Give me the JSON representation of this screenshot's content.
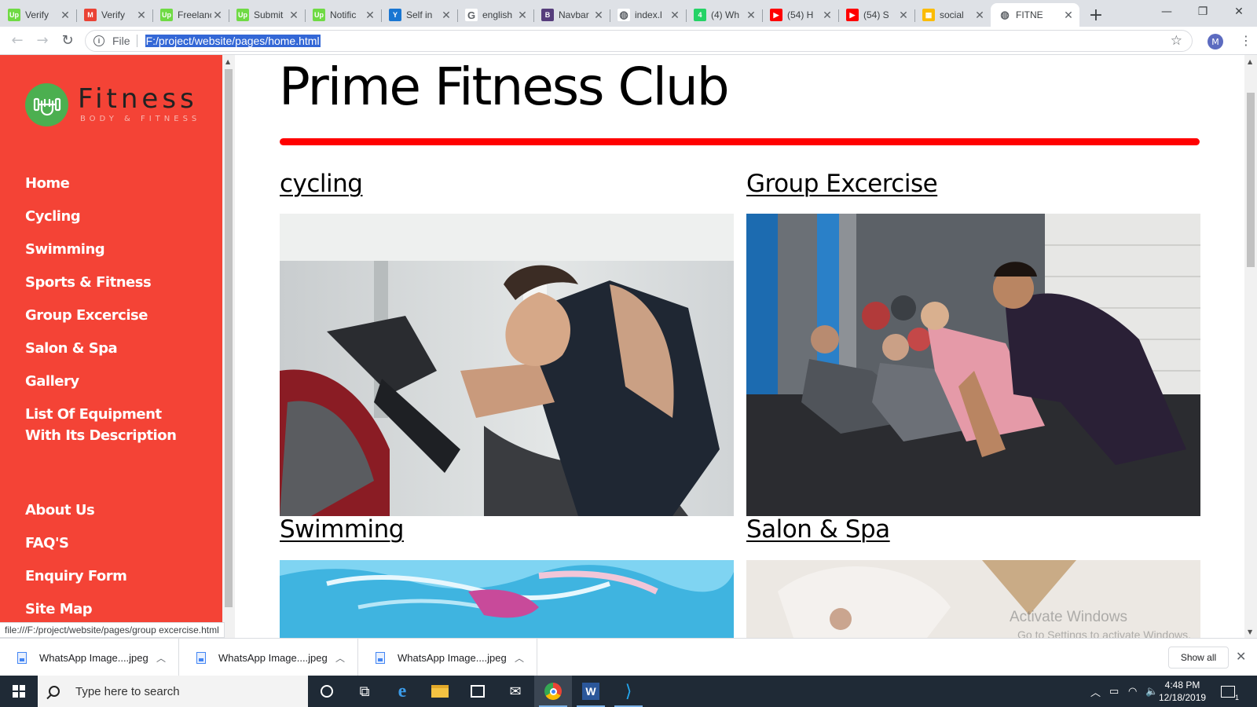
{
  "browser": {
    "tabs": [
      {
        "title": "Verify",
        "icon": "upwork-icon",
        "color": "#6fda44",
        "glyph": "Up"
      },
      {
        "title": "Verify",
        "icon": "gmail-icon",
        "color": "#ea4335",
        "glyph": "M"
      },
      {
        "title": "Freelance",
        "icon": "upwork-icon",
        "color": "#6fda44",
        "glyph": "Up"
      },
      {
        "title": "Submit",
        "icon": "upwork-icon",
        "color": "#6fda44",
        "glyph": "Up"
      },
      {
        "title": "Notific",
        "icon": "upwork-icon",
        "color": "#6fda44",
        "glyph": "Up"
      },
      {
        "title": "Self in",
        "icon": "yammer-icon",
        "color": "#1976d2",
        "glyph": "Y"
      },
      {
        "title": "english",
        "icon": "google-icon",
        "color": "#ffffff",
        "glyph": "G"
      },
      {
        "title": "Navbar",
        "icon": "bootstrap-icon",
        "color": "#563d7c",
        "glyph": "B"
      },
      {
        "title": "index.l",
        "icon": "globe-icon",
        "color": "#ffffff",
        "glyph": "◍"
      },
      {
        "title": "(4) Wh",
        "icon": "whatsapp-icon",
        "color": "#25d366",
        "glyph": "4"
      },
      {
        "title": "(54) H",
        "icon": "youtube-icon",
        "color": "#ff0000",
        "glyph": "▶"
      },
      {
        "title": "(54) S",
        "icon": "youtube-icon",
        "color": "#ff0000",
        "glyph": "▶"
      },
      {
        "title": "social",
        "icon": "sheets-icon",
        "color": "#fbbc04",
        "glyph": "▦"
      },
      {
        "title": "FITNE",
        "icon": "globe-icon",
        "color": "#ffffff",
        "glyph": "◍",
        "active": true
      }
    ],
    "new_tab": "+",
    "file_label": "File",
    "url": "F:/project/website/pages/home.html",
    "profile_initial": "M",
    "status_url": "file:///F:/project/website/pages/group excercise.html"
  },
  "sidebar": {
    "logo_word": "Fitness",
    "logo_tagline": "body & fitness",
    "nav": [
      {
        "label": "Home"
      },
      {
        "label": "Cycling"
      },
      {
        "label": "Swimming"
      },
      {
        "label": "Sports & Fitness"
      },
      {
        "label": "Group Excercise"
      },
      {
        "label": "Salon & Spa"
      },
      {
        "label": "Gallery"
      },
      {
        "label": "List Of Equipment With Its Description"
      }
    ],
    "nav_secondary": [
      {
        "label": "About Us"
      },
      {
        "label": "FAQ'S"
      },
      {
        "label": "Enquiry Form"
      },
      {
        "label": "Site Map"
      }
    ]
  },
  "main": {
    "title": "Prime Fitness Club",
    "accent_color": "#ff0000",
    "sidebar_color": "#f44336",
    "cards": [
      {
        "title": "cycling"
      },
      {
        "title": "Group Excercise"
      },
      {
        "title": "Swimming"
      },
      {
        "title": "Salon & Spa"
      }
    ]
  },
  "watermark": {
    "line1": "Activate Windows",
    "line2": "Go to Settings to activate Windows."
  },
  "downloads": {
    "items": [
      {
        "name": "WhatsApp Image....jpeg"
      },
      {
        "name": "WhatsApp Image....jpeg"
      },
      {
        "name": "WhatsApp Image....jpeg"
      }
    ],
    "show_all": "Show all"
  },
  "taskbar": {
    "search_placeholder": "Type here to search",
    "time": "4:48 PM",
    "date": "12/18/2019",
    "notification_count": "1"
  }
}
